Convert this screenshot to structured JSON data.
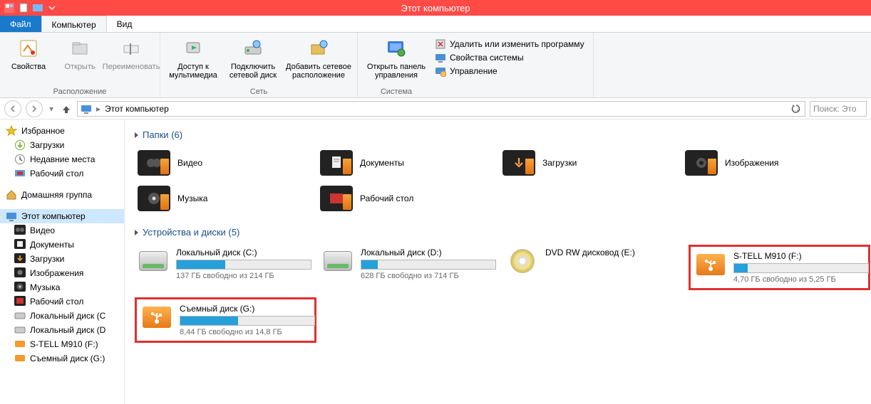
{
  "window": {
    "title": "Этот компьютер"
  },
  "ribbon": {
    "tabs": {
      "file": "Файл",
      "computer": "Компьютер",
      "view": "Вид"
    },
    "group_location": {
      "label": "Расположение",
      "properties": "Свойства",
      "open": "Открыть",
      "rename": "Переименовать"
    },
    "group_network": {
      "label": "Сеть",
      "media_access": "Доступ к мультимедиа",
      "map_drive": "Подключить сетевой диск",
      "add_net_location": "Добавить сетевое расположение"
    },
    "group_system": {
      "label": "Система",
      "control_panel": "Открыть панель управления",
      "uninstall": "Удалить или изменить программу",
      "sys_props": "Свойства системы",
      "manage": "Управление"
    }
  },
  "address": {
    "location": "Этот компьютер"
  },
  "search": {
    "placeholder": "Поиск: Это"
  },
  "tree": {
    "favorites": "Избранное",
    "downloads": "Загрузки",
    "recent": "Недавние места",
    "desktop": "Рабочий стол",
    "homegroup": "Домашняя группа",
    "this_pc": "Этот компьютер",
    "video": "Видео",
    "documents": "Документы",
    "downloads2": "Загрузки",
    "pictures": "Изображения",
    "music": "Музыка",
    "desktop2": "Рабочий стол",
    "ldisk_c": "Локальный диск (C",
    "ldisk_d": "Локальный диск (D",
    "stell": "S-TELL M910 (F:)",
    "removable_g": "Съемный диск (G:)"
  },
  "content": {
    "folders_header": "Папки (6)",
    "drives_header": "Устройства и диски (5)",
    "folders": [
      {
        "label": "Видео"
      },
      {
        "label": "Документы"
      },
      {
        "label": "Загрузки"
      },
      {
        "label": "Изображения"
      },
      {
        "label": "Музыка"
      },
      {
        "label": "Рабочий стол"
      }
    ],
    "drives": [
      {
        "label": "Локальный диск (C:)",
        "free": "137 ГБ свободно из 214 ГБ",
        "fill_pct": 36,
        "type": "hdd"
      },
      {
        "label": "Локальный диск (D:)",
        "free": "628 ГБ свободно из 714 ГБ",
        "fill_pct": 12,
        "type": "hdd"
      },
      {
        "label": "DVD RW дисковод (E:)",
        "free": "",
        "fill_pct": 0,
        "type": "dvd"
      },
      {
        "label": "S-TELL M910 (F:)",
        "free": "4,70 ГБ свободно из 5,25 ГБ",
        "fill_pct": 10,
        "type": "usb",
        "highlight": true
      },
      {
        "label": "Съемный диск (G:)",
        "free": "8,44 ГБ свободно из 14,8 ГБ",
        "fill_pct": 43,
        "type": "usb",
        "highlight": true
      }
    ]
  }
}
